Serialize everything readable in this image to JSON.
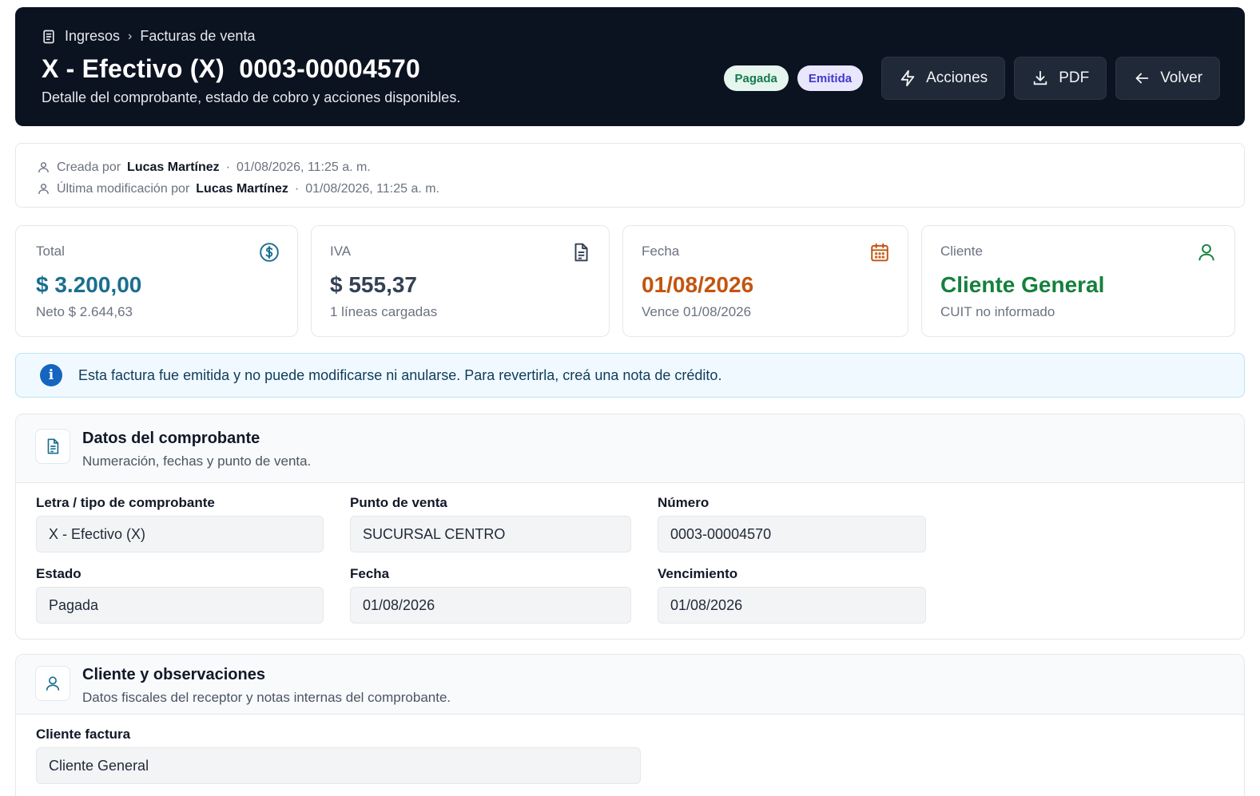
{
  "header": {
    "breadcrumb": [
      "Ingresos",
      "Facturas de venta"
    ],
    "title": "X - Efectivo (X)  0003-00004570",
    "subtitle": "Detalle del comprobante, estado de cobro y acciones disponibles.",
    "badges": {
      "paid": "Pagada",
      "issued": "Emitida"
    },
    "buttons": {
      "actions": "Acciones",
      "pdf": "PDF",
      "back": "Volver"
    },
    "icons": {
      "breadcrumb": "document-icon",
      "actions": "bolt-icon",
      "pdf": "download-icon",
      "back": "arrow-left-icon"
    }
  },
  "audit": {
    "created_label": "Creada por",
    "created_by": "Lucas Martínez",
    "created_at": "01/08/2026, 11:25 a. m.",
    "modified_label": "Última modificación por",
    "modified_by": "Lucas Martínez",
    "modified_at": "01/08/2026, 11:25 a. m.",
    "separator": "·"
  },
  "stats": {
    "total": {
      "label": "Total",
      "value": "$ 3.200,00",
      "sub": "Neto $ 2.644,63",
      "color": "#1a6f8f",
      "icon": "dollar-circle-icon"
    },
    "iva": {
      "label": "IVA",
      "value": "$ 555,37",
      "sub": "1 líneas cargadas",
      "color": "#334155",
      "icon": "document-icon"
    },
    "fecha": {
      "label": "Fecha",
      "value": "01/08/2026",
      "sub": "Vence 01/08/2026",
      "color": "#c2550f",
      "icon": "calendar-icon"
    },
    "cliente": {
      "label": "Cliente",
      "value": "Cliente General",
      "sub": "CUIT no informado",
      "color": "#15803d",
      "icon": "user-icon"
    }
  },
  "banner": {
    "text": "Esta factura fue emitida y no puede modificarse ni anularse. Para revertirla, creá una nota de crédito.",
    "icon": "info-icon"
  },
  "comprobante": {
    "title": "Datos del comprobante",
    "subtitle": "Numeración, fechas y punto de venta.",
    "fields": [
      {
        "label": "Letra / tipo de comprobante",
        "value": "X - Efectivo (X)"
      },
      {
        "label": "Punto de venta",
        "value": "SUCURSAL CENTRO"
      },
      {
        "label": "Número",
        "value": "0003-00004570"
      },
      {
        "label": "Estado",
        "value": "Pagada"
      },
      {
        "label": "Fecha",
        "value": "01/08/2026"
      },
      {
        "label": "Vencimiento",
        "value": "01/08/2026"
      }
    ]
  },
  "cliente": {
    "title": "Cliente y observaciones",
    "subtitle": "Datos fiscales del receptor y notas internas del comprobante.",
    "fields": [
      {
        "label": "Cliente factura",
        "value": "Cliente General"
      }
    ]
  },
  "colors": {
    "header_bg": "#0b1220",
    "banner_bg": "#f0f9ff",
    "info_blue": "#1565c0"
  }
}
